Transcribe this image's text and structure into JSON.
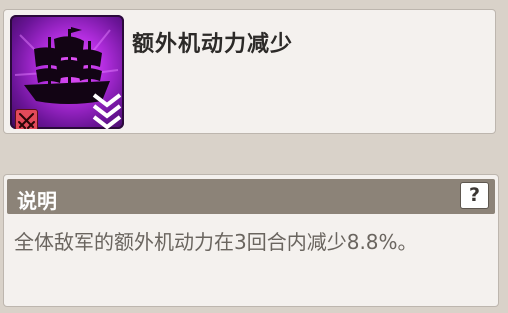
{
  "skill": {
    "name": "额外机动力减少",
    "icon": "pirate-ship-icon",
    "badge_icon": "crossed-swords-icon",
    "rank_icon": "triple-chevron-down-icon",
    "icon_color": "#b42ee0",
    "badge_color": "#e24a5a"
  },
  "description": {
    "title": "说明",
    "help_label": "?",
    "text": "全体敌军的额外机动力在3回合内减少8.8%。"
  }
}
